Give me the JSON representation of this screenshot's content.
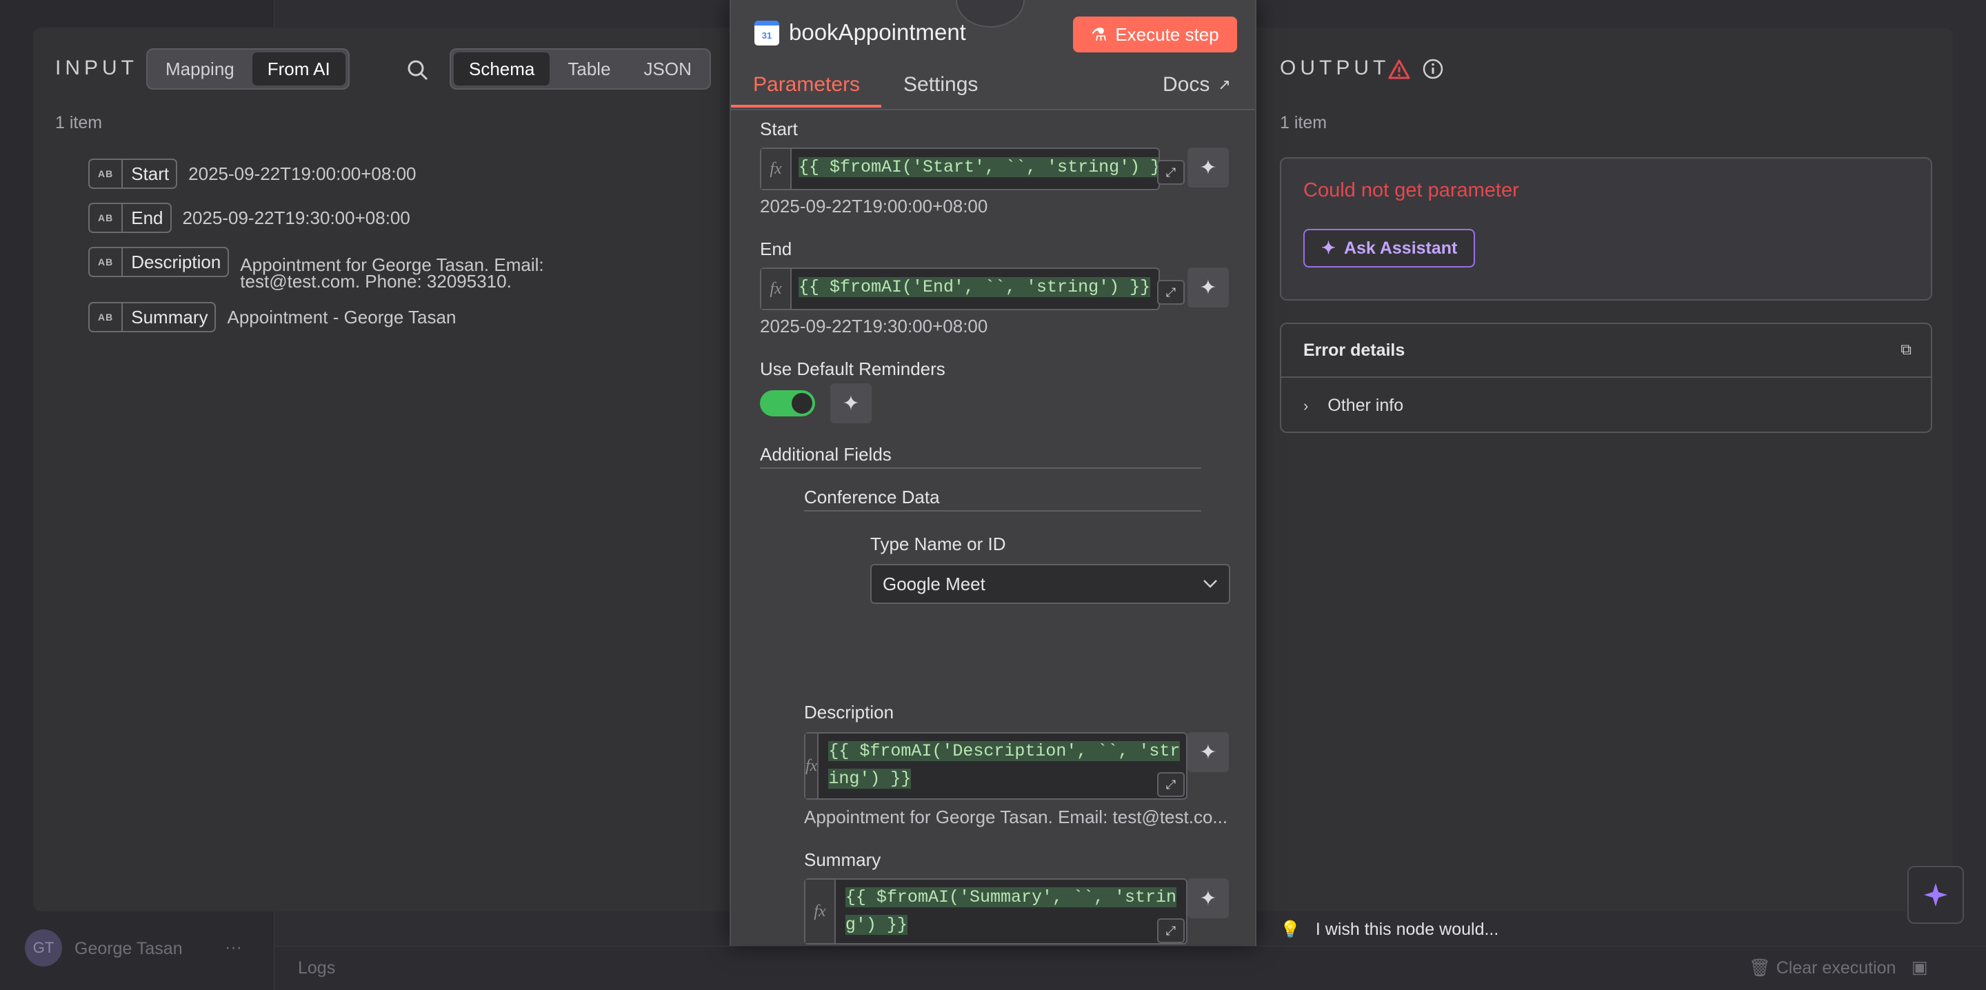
{
  "background": {
    "user_name": "George Tasan",
    "user_initials": "GT",
    "user_menu": "···",
    "logs_label": "Logs",
    "clear_execution": "Clear execution"
  },
  "input": {
    "title": "INPUT",
    "mode_tabs": [
      "Mapping",
      "From AI"
    ],
    "active_mode": "From AI",
    "view_tabs": [
      "Schema",
      "Table",
      "JSON"
    ],
    "active_view": "Schema",
    "item_count": "1 item",
    "fields": [
      {
        "type": "AB",
        "name": "Start",
        "value": "2025-09-22T19:00:00+08:00"
      },
      {
        "type": "AB",
        "name": "End",
        "value": "2025-09-22T19:30:00+08:00"
      },
      {
        "type": "AB",
        "name": "Description",
        "value": "Appointment for George Tasan. Email: test@test.com. Phone: 32095310."
      },
      {
        "type": "AB",
        "name": "Summary",
        "value": "Appointment - George Tasan"
      }
    ]
  },
  "node": {
    "title": "bookAppointment",
    "calendar_icon_text": "31",
    "execute_label": "Execute step",
    "tabs": [
      "Parameters",
      "Settings"
    ],
    "active_tab": "Parameters",
    "docs_label": "Docs",
    "params": {
      "start_label": "Start",
      "start_expr": "{{ $fromAI('Start', ``, 'string') }}",
      "start_result": "2025-09-22T19:00:00+08:00",
      "end_label": "End",
      "end_expr": "{{ $fromAI('End', ``, 'string') }}",
      "end_result": "2025-09-22T19:30:00+08:00",
      "reminders_label": "Use Default Reminders",
      "reminders_on": true,
      "additional_fields": "Additional Fields",
      "conference_data": "Conference Data",
      "type_label": "Type Name or ID",
      "type_value": "Google Meet",
      "description_label": "Description",
      "description_expr_line1": "{{ $fromAI('Description', ``, 'str",
      "description_expr_line2": "ing') }}",
      "description_result": "Appointment for George Tasan. Email: test@test.co...",
      "summary_label": "Summary",
      "summary_expr_line1": "{{ $fromAI('Summary', ``, 'strin",
      "summary_expr_line2": "g') }}"
    },
    "fx_label": "fx"
  },
  "output": {
    "title": "OUTPUT",
    "item_count": "1 item",
    "error_message": "Could not get parameter",
    "ask_assistant": "Ask Assistant",
    "error_details": "Error details",
    "other_info": "Other info",
    "feedback": "I wish this node would..."
  },
  "colors": {
    "accent": "#ff6d5a",
    "error": "#e5484d",
    "assistant": "#9b6fe8",
    "toggle_on": "#3fbf5a"
  }
}
